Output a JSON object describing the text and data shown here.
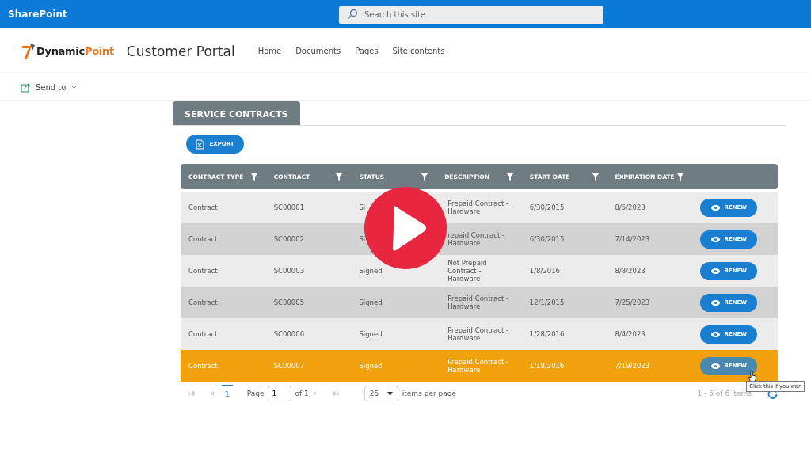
{
  "top_bar": {
    "app_name": "SharePoint",
    "search": {
      "placeholder": "Search this site"
    }
  },
  "site_header": {
    "logo_parts": [
      "Dynamic",
      "Point"
    ],
    "title": "Customer Portal",
    "nav": [
      {
        "label": "Home"
      },
      {
        "label": "Documents"
      },
      {
        "label": "Pages"
      },
      {
        "label": "Site contents"
      }
    ]
  },
  "command_bar": {
    "send_to": "Send to"
  },
  "panel": {
    "tab": "SERVICE CONTRACTS",
    "export_button": "EXPORT"
  },
  "table": {
    "columns": [
      "CONTRACT TYPE",
      "CONTRACT",
      "STATUS",
      "DESCRIPTION",
      "START DATE",
      "EXPIRATION DATE"
    ],
    "rows": [
      {
        "cells": [
          "Contract",
          "SC00001",
          "Si",
          "Prepaid Contract - Hardware",
          "6/30/2015",
          "8/5/2023"
        ],
        "action": "RENEW",
        "selected": false
      },
      {
        "cells": [
          "Contract",
          "SC00002",
          "Si",
          "repaid Contract - Hardware",
          "6/30/2015",
          "7/14/2023"
        ],
        "action": "RENEW",
        "selected": false
      },
      {
        "cells": [
          "Contract",
          "SC00003",
          "Signed",
          "Not Prepaid Contract - Hardware",
          "1/8/2016",
          "8/8/2023"
        ],
        "action": "RENEW",
        "selected": false
      },
      {
        "cells": [
          "Contract",
          "SC00005",
          "Signed",
          "Prepaid Contract - Hardware",
          "12/1/2015",
          "7/25/2023"
        ],
        "action": "RENEW",
        "selected": false
      },
      {
        "cells": [
          "Contract",
          "SC00006",
          "Signed",
          "Prepaid Contract - Hardware",
          "1/28/2016",
          "8/4/2023"
        ],
        "action": "RENEW",
        "selected": false
      },
      {
        "cells": [
          "Contract",
          "SC00007",
          "Signed",
          "Prepaid Contract - Hardware",
          "1/18/2016",
          "7/19/2023"
        ],
        "action": "RENEW",
        "selected": true
      }
    ]
  },
  "pager": {
    "current_page": "1",
    "page_label": "Page",
    "page_value": "1",
    "of_label": "of 1",
    "page_size": "25",
    "page_size_label": "items per page",
    "summary": "1 - 6 of 6 items"
  },
  "tooltip": "Click this if you wan"
}
